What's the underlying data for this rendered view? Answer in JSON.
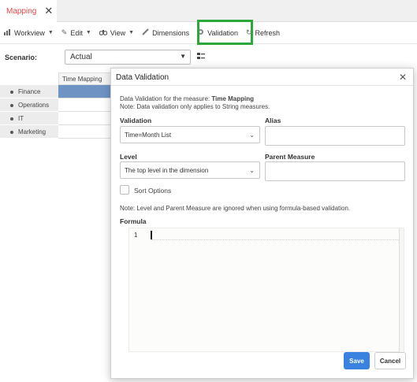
{
  "tab": {
    "label": "Mapping",
    "close": "✕"
  },
  "toolbar": {
    "items": [
      {
        "label": "Workview",
        "icon": "chart-icon",
        "caret": true
      },
      {
        "label": "Edit",
        "icon": "pencil-icon",
        "caret": true
      },
      {
        "label": "View",
        "icon": "binoculars-icon",
        "caret": true
      },
      {
        "label": "Dimensions",
        "icon": "ruler-icon",
        "caret": false
      },
      {
        "label": "Validation",
        "icon": "gear-icon",
        "caret": false
      },
      {
        "label": "Refresh",
        "icon": "refresh-icon",
        "caret": false
      }
    ],
    "highlight_color": "#2aa83c"
  },
  "scenario": {
    "label": "Scenario:",
    "value": "Actual"
  },
  "grid": {
    "column_header": "Time Mapping",
    "rows": [
      "Finance",
      "Operations",
      "IT",
      "Marketing"
    ],
    "selected_color": "#6f93c3"
  },
  "dialog": {
    "title": "Data Validation",
    "intro_prefix": "Data Validation for the measure: ",
    "measure": "Time Mapping",
    "note": "Note: Data validation only applies to String measures.",
    "validation_label": "Validation",
    "validation_value": "Time=Month List",
    "alias_label": "Alias",
    "level_label": "Level",
    "level_value": "The top level in the dimension",
    "parent_label": "Parent Measure",
    "sort_label": "Sort Options",
    "level_note": "Note: Level and Parent Measure are ignored when using formula-based validation.",
    "formula_label": "Formula",
    "line_number": "1",
    "save_label": "Save",
    "cancel_label": "Cancel",
    "save_color": "#3a82e0"
  }
}
